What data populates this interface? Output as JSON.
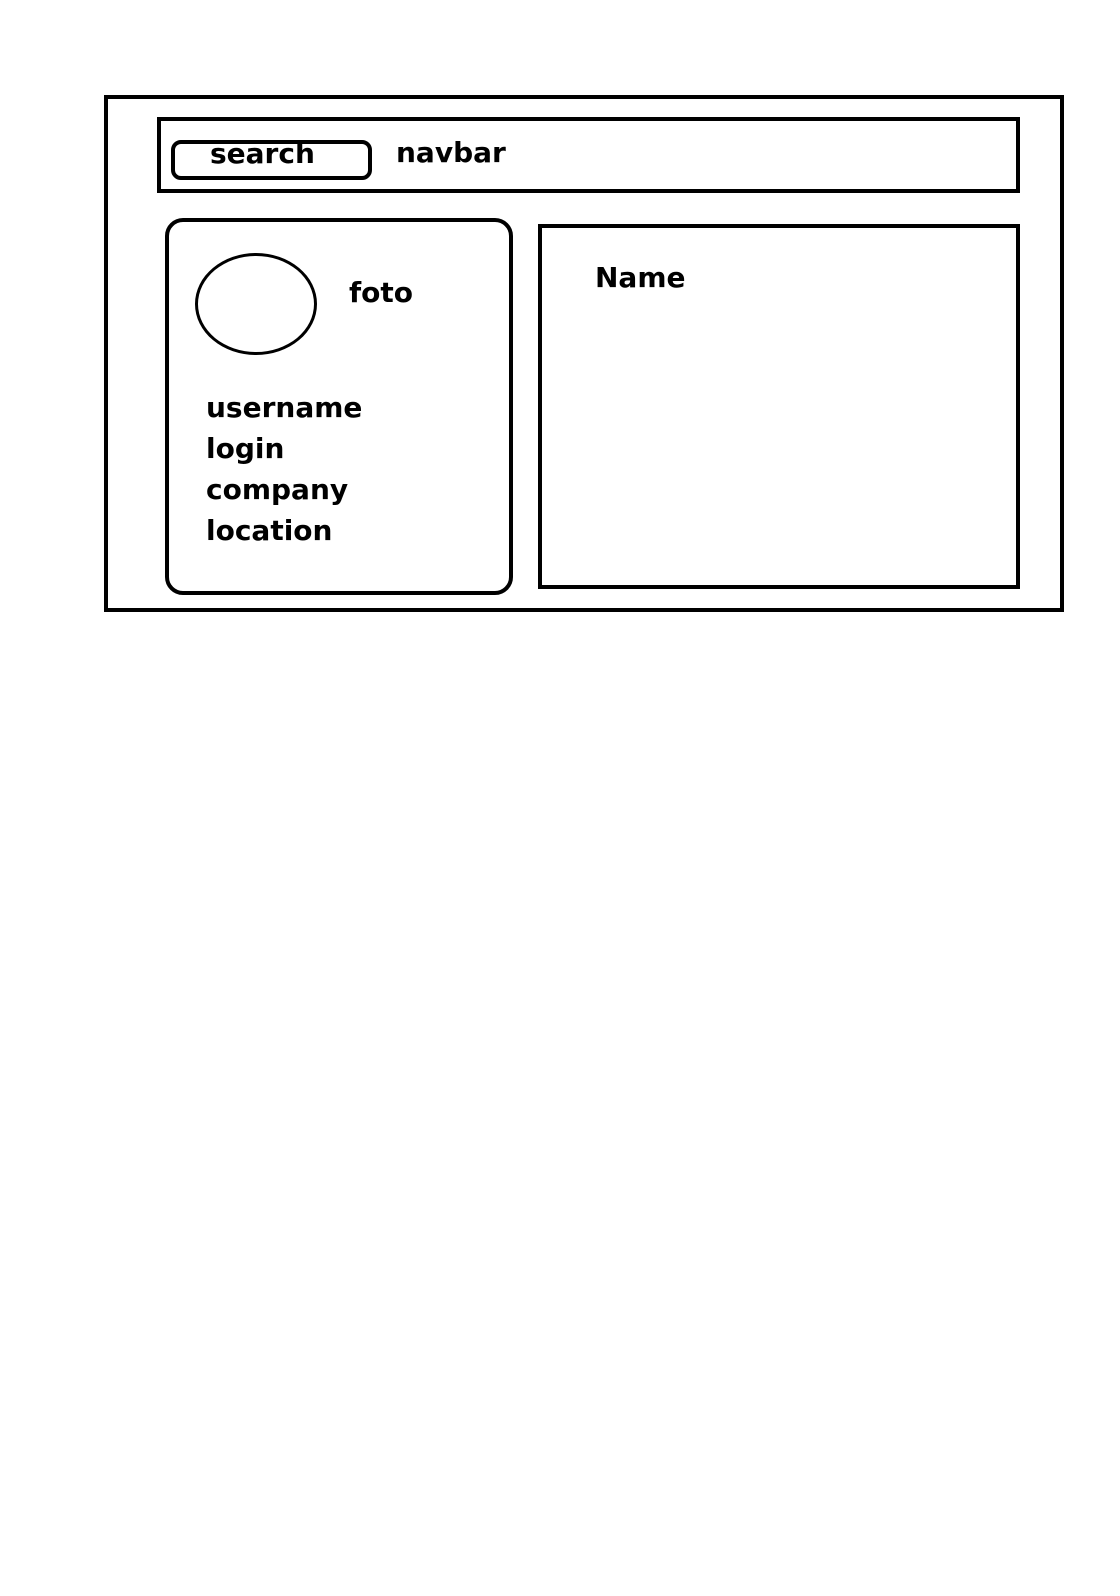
{
  "navbar": {
    "search_label": "search",
    "title": "navbar"
  },
  "profile": {
    "photo_label": "foto",
    "fields": [
      "username",
      "login",
      "company",
      "location"
    ]
  },
  "details": {
    "name_label": "Name"
  }
}
